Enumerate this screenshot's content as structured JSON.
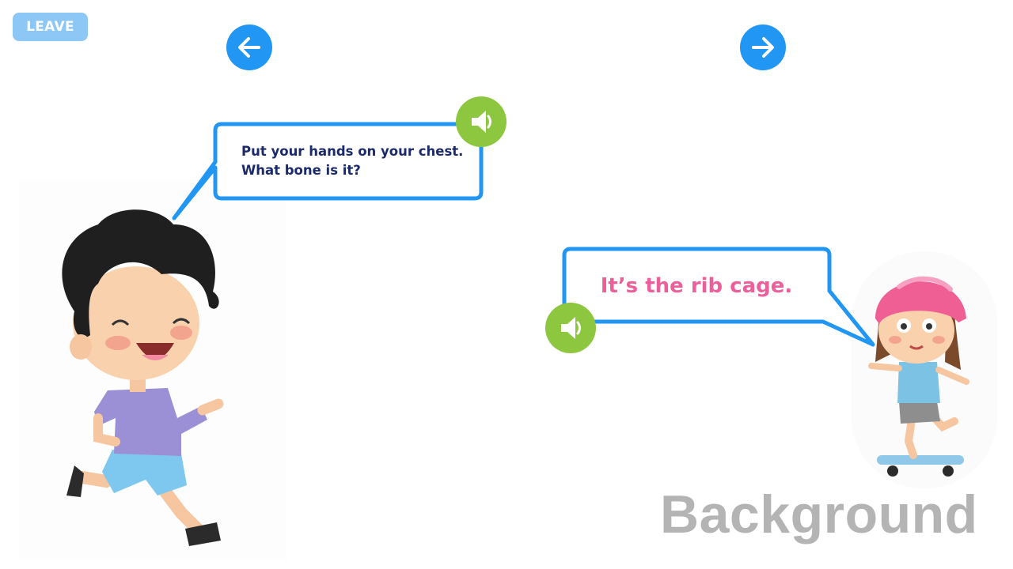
{
  "controls": {
    "leave_label": "LEAVE",
    "prev_icon": "arrow-left-icon",
    "next_icon": "arrow-right-icon"
  },
  "dialogue": {
    "question_lines": [
      "Put your hands on your chest.",
      "What bone is it?"
    ],
    "answer": "It’s the rib cage."
  },
  "audio": {
    "icon": "speaker-icon"
  },
  "watermark": "Background",
  "colors": {
    "nav_blue": "#2196f3",
    "leave_blue": "#8cc7f5",
    "bubble_border": "#2196f3",
    "speaker_green": "#8dc63f",
    "question_text": "#1b2a6b",
    "answer_text": "#ec5f9b",
    "watermark_gray": "#b4b4b4"
  }
}
